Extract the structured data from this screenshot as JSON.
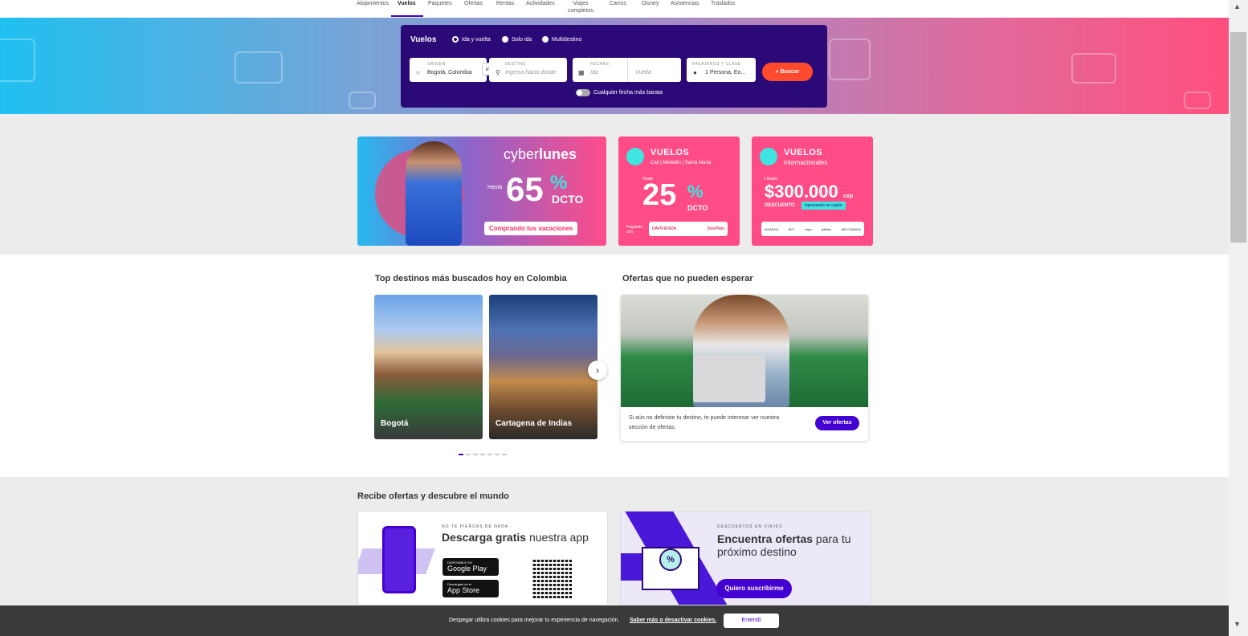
{
  "nav": {
    "items": [
      "Alojamientos",
      "Vuelos",
      "Paquetes",
      "Ofertas",
      "Rentas",
      "Actividades",
      "Viajes completos",
      "Carros",
      "Disney",
      "Asistencias",
      "Traslados"
    ],
    "viajes_line1": "Viajes",
    "viajes_line2": "completos"
  },
  "search": {
    "title": "Vuelos",
    "trip_types": [
      "Ida y vuelta",
      "Solo ida",
      "Multidestino"
    ],
    "origin_label": "ORIGEN",
    "origin_value": "Bogotá, Colombia",
    "destination_label": "DESTINO",
    "destination_placeholder": "Ingresa hacia dónde",
    "dates_label": "FECHAS",
    "ida_placeholder": "Ida",
    "vuelta_placeholder": "Vuelta",
    "passengers_label": "PASAJEROS Y CLASE",
    "passengers_value": "1 Persona, Eo...",
    "search_button": "Buscar",
    "cheapest_toggle": "Cualquier fecha más barata"
  },
  "banners": {
    "cyber": {
      "brand_pre": "cyber",
      "brand_bold": "lunes",
      "hasta": "Hasta",
      "number": "65",
      "percent": "%",
      "dcto": "DCTO",
      "cta": "Comprando tus vacaciones"
    },
    "nacional": {
      "head": "VUELOS",
      "sub": "Cali | Medellín | Santa Marta",
      "hasta": "Hasta",
      "number": "25",
      "percent": "%",
      "dcto": "DCTO",
      "pago": "Pagando con",
      "logo1": "DAVIVIENDA",
      "logo2": "DaviPlata"
    },
    "internacional": {
      "head": "VUELOS",
      "sub": "Internacionales",
      "llevate": "Llévate",
      "amount": "$300.000",
      "currency": "cop",
      "desc": "DESCUENTO",
      "tag": "ingresando un cupón",
      "logos": [
        "AVIANCA",
        "SKY",
        "copa",
        "jetBlue",
        "AIR CANADA"
      ]
    }
  },
  "destinations": {
    "title": "Top destinos más buscados hoy en Colombia",
    "cards": [
      "Bogotá",
      "Cartagena de Indias"
    ]
  },
  "offers": {
    "title": "Ofertas que no pueden esperar",
    "text": "Si aún no definiste tu destino, te puede interesar ver nuestra sección de ofertas.",
    "button": "Ver ofertas"
  },
  "bottom": {
    "title": "Recibe ofertas y descubre el mundo",
    "app_cap": "NO TE PIERDAS DE NADA",
    "app_bold": "Descarga gratis",
    "app_rest": " nuestra app",
    "google_small": "DISPONIBLE EN",
    "google_big": "Google Play",
    "apple_small": "Descárgalo en el",
    "apple_big": "App Store",
    "sub_cap": "DESCUENTOS EN VIAJES",
    "sub_bold": "Encuentra ofertas",
    "sub_rest": " para tu próximo destino",
    "sub_button": "Quiero suscribirme"
  },
  "cookie": {
    "text": "Despegar utiliza cookies para mejorar tu experiencia de navegación.",
    "link": "Saber más o desactivar cookies.",
    "button": "Entendí"
  },
  "colors": {
    "accent": "#4300d2",
    "search_bg": "#2b0a78",
    "buscar": "#ff4a2e",
    "promo_pink": "#ff4c86"
  }
}
